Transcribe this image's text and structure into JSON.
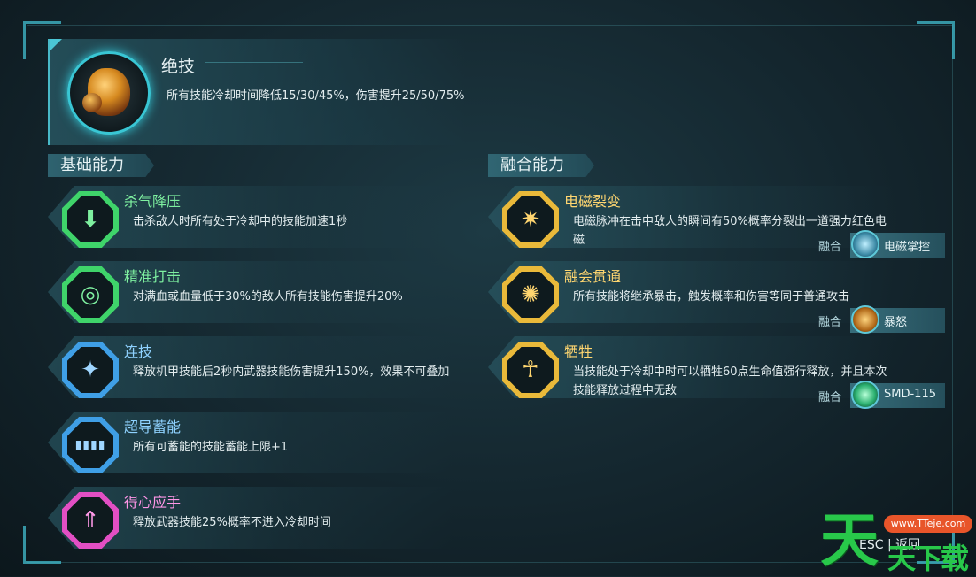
{
  "ultimate": {
    "title": "绝技",
    "description": "所有技能冷却时间降低15/30/45%，伤害提升25/50/75%",
    "icon": "gauntlet-icon"
  },
  "basic": {
    "header": "基础能力",
    "skills": [
      {
        "name": "杀气降压",
        "desc": "击杀敌人时所有处于冷却中的技能加速1秒",
        "icon": "blade-icon",
        "glyph": "⬇",
        "color": "green"
      },
      {
        "name": "精准打击",
        "desc": "对满血或血量低于30%的敌人所有技能伤害提升20%",
        "icon": "swirl-icon",
        "glyph": "◎",
        "color": "green"
      },
      {
        "name": "连技",
        "desc": "释放机甲技能后2秒内武器技能伤害提升150%，效果不可叠加",
        "icon": "wings-icon",
        "glyph": "✦",
        "color": "blue"
      },
      {
        "name": "超导蓄能",
        "desc": "所有可蓄能的技能蓄能上限+1",
        "icon": "battery-icon",
        "glyph": "▮▮▮▮",
        "color": "blue"
      },
      {
        "name": "得心应手",
        "desc": "释放武器技能25%概率不进入冷却时间",
        "icon": "arrow-up-icon",
        "glyph": "⇑",
        "color": "pink"
      }
    ]
  },
  "fusion": {
    "header": "融合能力",
    "fuse_label": "融合",
    "skills": [
      {
        "name": "电磁裂变",
        "desc": "电磁脉冲在击中敌人的瞬间有50%概率分裂出一道强力红色电磁",
        "icon": "shatter-icon",
        "glyph": "✷",
        "fuse_with": "电磁掌控",
        "fuse_icon": "electro-fist-icon"
      },
      {
        "name": "融会贯通",
        "desc": "所有技能将继承暴击，触发概率和伤害等同于普通攻击",
        "icon": "spiral-blade-icon",
        "glyph": "✺",
        "fuse_with": "暴怒",
        "fuse_icon": "rage-icon"
      },
      {
        "name": "牺牲",
        "desc": "当技能处于冷却中时可以牺牲60点生命值强行释放，并且本次技能释放过程中无敌",
        "icon": "ankh-icon",
        "glyph": "☥",
        "fuse_with": "SMD-115",
        "fuse_icon": "drone-icon"
      }
    ]
  },
  "footer": {
    "esc_key": "ESC",
    "separator": "|",
    "back_label": "返回"
  },
  "watermark": {
    "big_char": "天",
    "small_chars": "天下载",
    "url": "www.TTeje.com"
  },
  "colors": {
    "accent": "#3fb3c4",
    "green": "#3fd46a",
    "blue": "#3f9fe6",
    "pink": "#e24fc4",
    "gold": "#e9b93a"
  }
}
